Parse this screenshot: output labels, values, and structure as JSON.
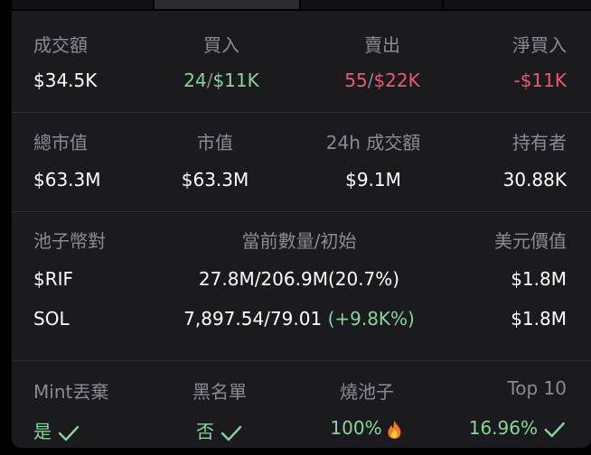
{
  "stats": {
    "volume_label": "成交額",
    "volume_value": "$34.5K",
    "buy_label": "買入",
    "buy_count": "24",
    "buy_sep": "/",
    "buy_amount": "$11K",
    "sell_label": "賣出",
    "sell_count": "55",
    "sell_sep": "/",
    "sell_amount": "$22K",
    "net_buy_label": "淨買入",
    "net_buy_value": "-$11K"
  },
  "market": {
    "total_mcap_label": "總市值",
    "total_mcap_value": "$63.3M",
    "mcap_label": "市值",
    "mcap_value": "$63.3M",
    "volume24_label": "24h 成交額",
    "volume24_value": "$9.1M",
    "holders_label": "持有者",
    "holders_value": "30.88K"
  },
  "pool": {
    "pair_label": "池子幣對",
    "amount_label": "當前數量/初始",
    "usd_label": "美元價值",
    "rows": [
      {
        "token": "$RIF",
        "amount": "27.8M/206.9M(20.7%)",
        "change": "",
        "usd": "$1.8M"
      },
      {
        "token": "SOL",
        "amount": "7,897.54/79.01 ",
        "change": "(+9.8K%)",
        "usd": "$1.8M"
      }
    ]
  },
  "security": {
    "mint_label": "Mint丟棄",
    "mint_value": "是",
    "blacklist_label": "黑名單",
    "blacklist_value": "否",
    "burn_label": "燒池子",
    "burn_value": "100%",
    "top10_label": "Top 10",
    "top10_value": "16.96%"
  },
  "colors": {
    "panel_bg": "#1b1b1f",
    "positive": "#86d59a",
    "negative": "#f0566b",
    "label": "#8a8a93"
  },
  "icons": {
    "mint_status": "check-icon",
    "blacklist_status": "check-icon",
    "burn_status": "fire-icon",
    "top10_status": "check-icon"
  }
}
